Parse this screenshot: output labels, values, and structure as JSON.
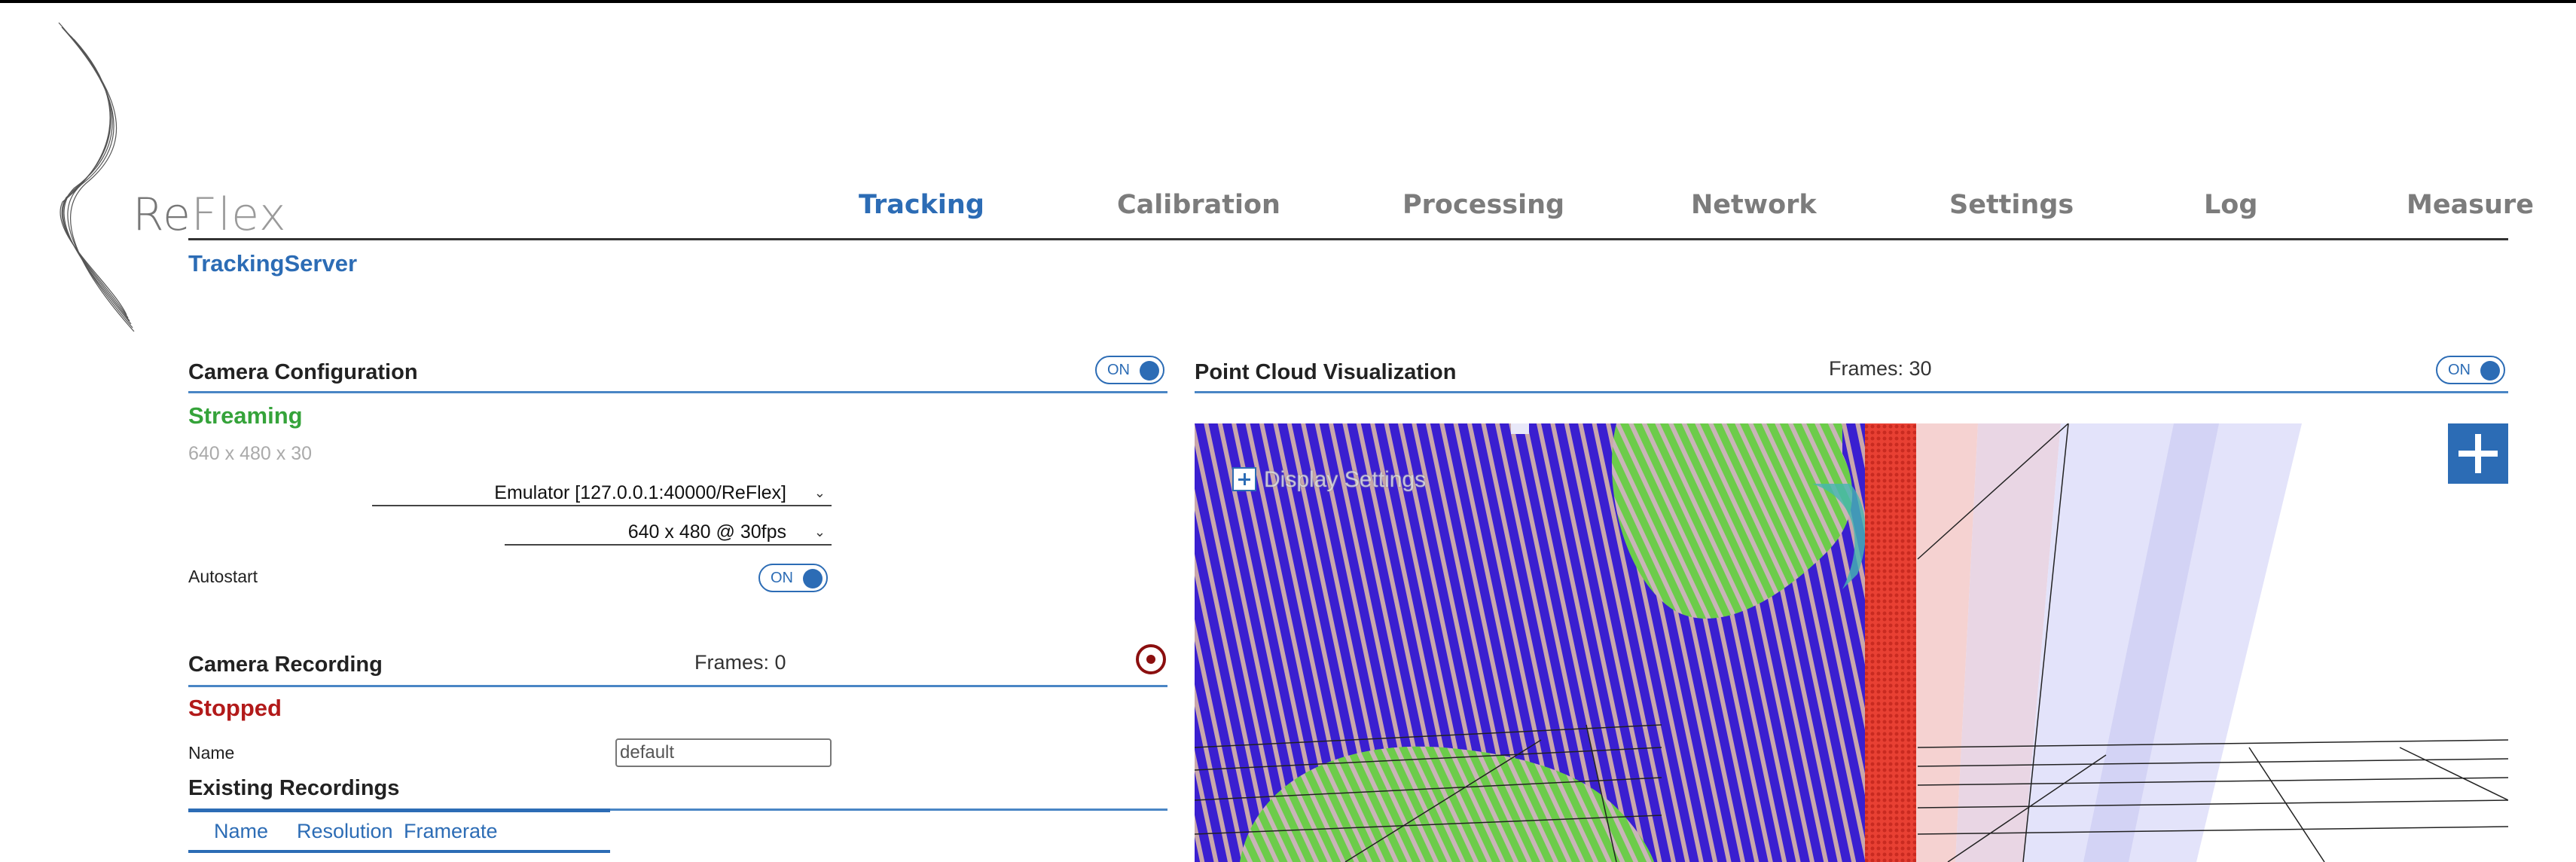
{
  "app": {
    "logo_text": "ReFlex",
    "subtitle": "TrackingServer"
  },
  "nav": {
    "items": [
      {
        "label": "Tracking",
        "active": true
      },
      {
        "label": "Calibration",
        "active": false
      },
      {
        "label": "Processing",
        "active": false
      },
      {
        "label": "Network",
        "active": false
      },
      {
        "label": "Settings",
        "active": false
      },
      {
        "label": "Log",
        "active": false
      },
      {
        "label": "Measure",
        "active": false
      }
    ]
  },
  "camera_config": {
    "title": "Camera Configuration",
    "toggle": "ON",
    "status": "Streaming",
    "resolution_info": "640 x 480 x 30",
    "device_select": "Emulator [127.0.0.1:40000/ReFlex]",
    "mode_select": "640 x 480 @ 30fps",
    "autostart_label": "Autostart",
    "autostart_toggle": "ON"
  },
  "camera_recording": {
    "title": "Camera Recording",
    "frames": "Frames: 0",
    "status": "Stopped",
    "name_label": "Name",
    "name_value": "default",
    "existing_title": "Existing Recordings",
    "columns": [
      "Name",
      "Resolution",
      "Framerate"
    ]
  },
  "point_cloud": {
    "title": "Point Cloud Visualization",
    "frames": "Frames: 30",
    "toggle": "ON",
    "display_settings": "Display Settings"
  },
  "colors": {
    "accent": "#2c6cb5",
    "streaming": "#35a33a",
    "stopped": "#b21a1a",
    "record": "#8b0f0f"
  }
}
